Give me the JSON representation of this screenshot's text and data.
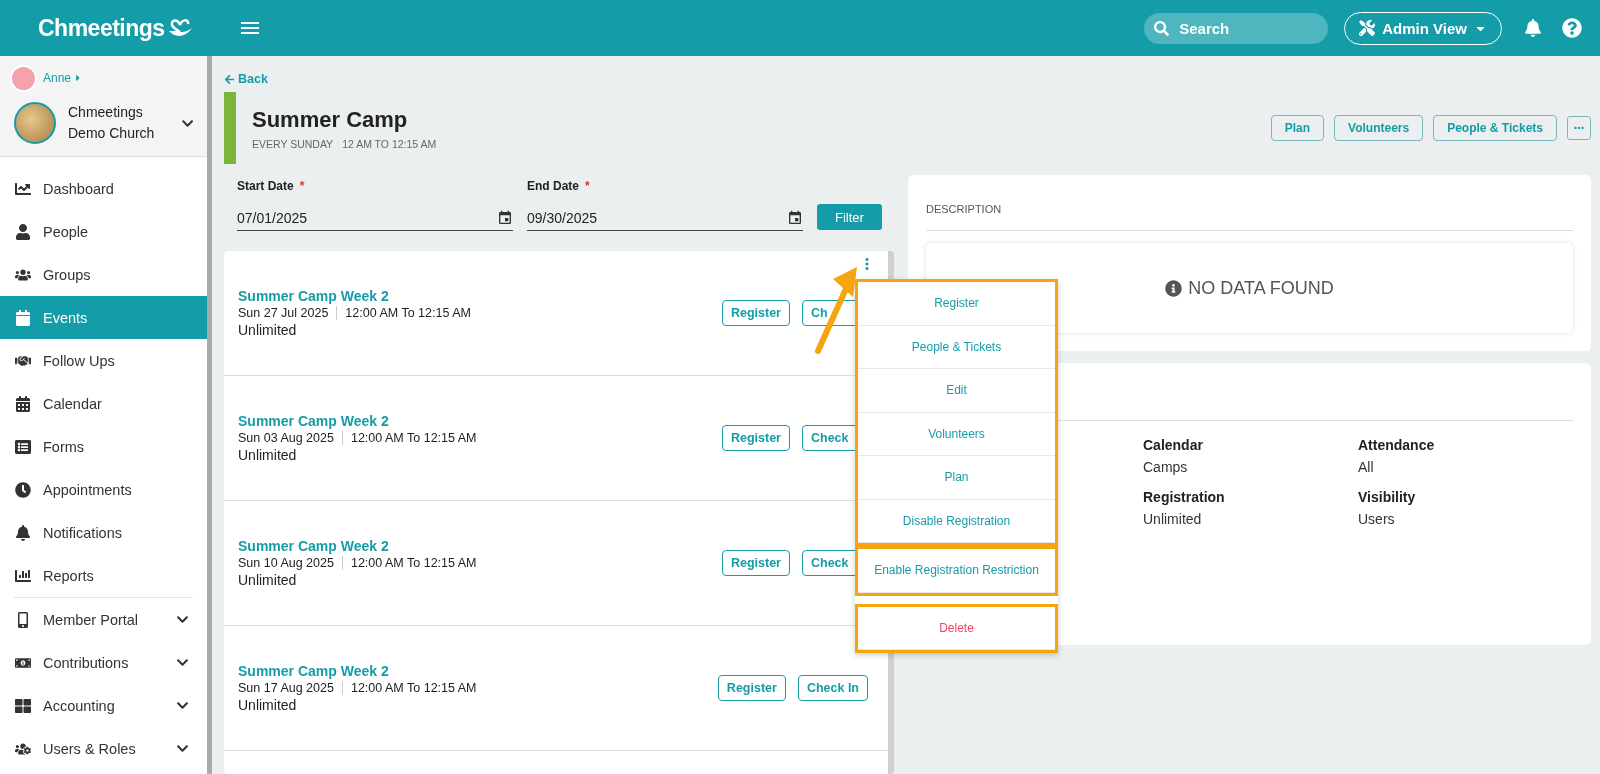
{
  "header": {
    "logo": "Chmeetings",
    "search": {
      "placeholder": "Search"
    },
    "view_switch": "Admin View"
  },
  "sidebar": {
    "user": "Anne",
    "church": "Chmeetings Demo Church",
    "items": [
      {
        "label": "Dashboard",
        "selected": false,
        "expandable": false
      },
      {
        "label": "People",
        "selected": false,
        "expandable": false
      },
      {
        "label": "Groups",
        "selected": false,
        "expandable": false
      },
      {
        "label": "Events",
        "selected": true,
        "expandable": false
      },
      {
        "label": "Follow Ups",
        "selected": false,
        "expandable": false
      },
      {
        "label": "Calendar",
        "selected": false,
        "expandable": false
      },
      {
        "label": "Forms",
        "selected": false,
        "expandable": false
      },
      {
        "label": "Appointments",
        "selected": false,
        "expandable": false
      },
      {
        "label": "Notifications",
        "selected": false,
        "expandable": false
      },
      {
        "label": "Reports",
        "selected": false,
        "expandable": false
      },
      {
        "label": "Member Portal",
        "selected": false,
        "expandable": true
      },
      {
        "label": "Contributions",
        "selected": false,
        "expandable": true
      },
      {
        "label": "Accounting",
        "selected": false,
        "expandable": true
      },
      {
        "label": "Users & Roles",
        "selected": false,
        "expandable": true
      }
    ]
  },
  "page": {
    "back": "Back",
    "title": "Summer Camp",
    "recurrence": "EVERY SUNDAY",
    "hours": "12 AM TO 12:15 AM",
    "actions": [
      "Plan",
      "Volunteers",
      "People & Tickets"
    ]
  },
  "filters": {
    "start_date": {
      "label": "Start Date",
      "required_mark": "*",
      "value": "07/01/2025"
    },
    "end_date": {
      "label": "End Date",
      "required_mark": "*",
      "value": "09/30/2025"
    },
    "button": "Filter"
  },
  "events": [
    {
      "title": "Summer Camp Week 2",
      "date": "Sun 27 Jul  2025",
      "time": "12:00 AM To 12:15 AM",
      "capacity": "Unlimited",
      "buttons": [
        "Register",
        "Ch"
      ]
    },
    {
      "title": "Summer Camp Week 2",
      "date": "Sun 03 Aug  2025",
      "time": "12:00 AM To 12:15 AM",
      "capacity": "Unlimited",
      "buttons": [
        "Register",
        "Check"
      ]
    },
    {
      "title": "Summer Camp Week 2",
      "date": "Sun 10 Aug  2025",
      "time": "12:00 AM To 12:15 AM",
      "capacity": "Unlimited",
      "buttons": [
        "Register",
        "Check"
      ]
    },
    {
      "title": "Summer Camp Week 2",
      "date": "Sun 17 Aug  2025",
      "time": "12:00 AM To 12:15 AM",
      "capacity": "Unlimited",
      "buttons": [
        "Register",
        "Check In"
      ]
    }
  ],
  "description": {
    "label": "DESCRIPTION",
    "empty": "NO DATA FOUND"
  },
  "details": [
    {
      "label": "Calendar",
      "value": "Camps"
    },
    {
      "label": "Attendance",
      "value": "All"
    },
    {
      "label": "Registration",
      "value": "Unlimited"
    },
    {
      "label": "Visibility",
      "value": "Users"
    }
  ],
  "menu": {
    "groups": [
      {
        "highlighted": true,
        "items": [
          {
            "label": "Register",
            "kind": "normal"
          },
          {
            "label": "People & Tickets",
            "kind": "normal"
          },
          {
            "label": "Edit",
            "kind": "normal"
          },
          {
            "label": "Volunteers",
            "kind": "normal"
          },
          {
            "label": "Plan",
            "kind": "normal"
          },
          {
            "label": "Disable Registration",
            "kind": "normal"
          }
        ]
      },
      {
        "highlighted": true,
        "items": [
          {
            "label": "Enable Registration Restriction",
            "kind": "normal"
          }
        ]
      },
      {
        "highlighted": true,
        "items": [
          {
            "label": "Delete",
            "kind": "danger"
          }
        ]
      }
    ],
    "pointer_arrow": true
  }
}
